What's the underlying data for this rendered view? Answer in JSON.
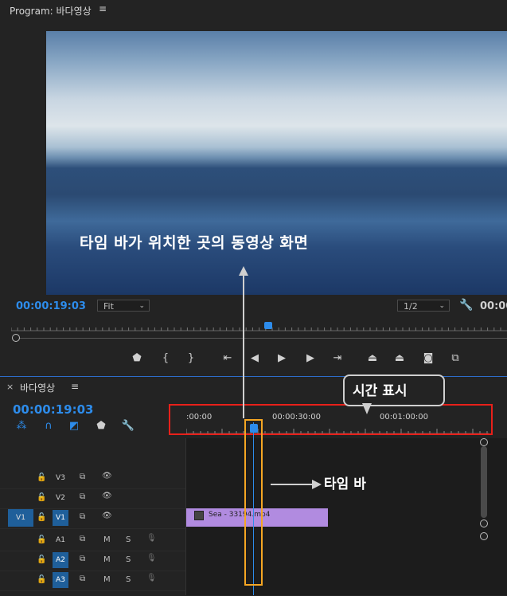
{
  "program": {
    "title": "Program: 바다영상",
    "menu_icon": "hamburger-icon",
    "timecode": "00:00:19:03",
    "timecode_right": "00:00",
    "zoom_label": "Fit",
    "resolution_label": "1/2",
    "overlay_annotation": "타임 바가 위치한 곳의 동영상 화면"
  },
  "transport": {
    "icons": [
      "marker-icon",
      "in-point-icon",
      "out-point-icon",
      "go-to-in-icon",
      "step-back-icon",
      "play-icon",
      "step-forward-icon",
      "go-to-out-icon",
      "lift-icon",
      "extract-icon",
      "export-frame-icon",
      "comparison-icon"
    ],
    "glyphs": [
      "⬟",
      "{",
      "}",
      "⇤",
      "◀",
      "▶",
      "▶",
      "⇥",
      "⏏",
      "⏏",
      "📷",
      "⧉"
    ]
  },
  "sequence": {
    "close": "×",
    "title": "바다영상",
    "timecode": "00:00:19:03",
    "ruler_labels": [
      ":00:00",
      "00:00:30:00",
      "00:01:00:00"
    ],
    "time_callout": "시간 표시",
    "timebar_callout": "타임 바",
    "tracks": {
      "v3": "V3",
      "v2": "V2",
      "v1": "V1",
      "v1_src": "V1",
      "a1": "A1",
      "a2": "A2",
      "a3": "A3",
      "m": "M",
      "s": "S"
    },
    "clip_label": "Sea - 33194.mp4"
  },
  "colors": {
    "accent_blue": "#2d8ceb",
    "clip_purple": "#b18be0",
    "red_annotation": "#e8201a",
    "orange_annotation": "#f5a623"
  }
}
